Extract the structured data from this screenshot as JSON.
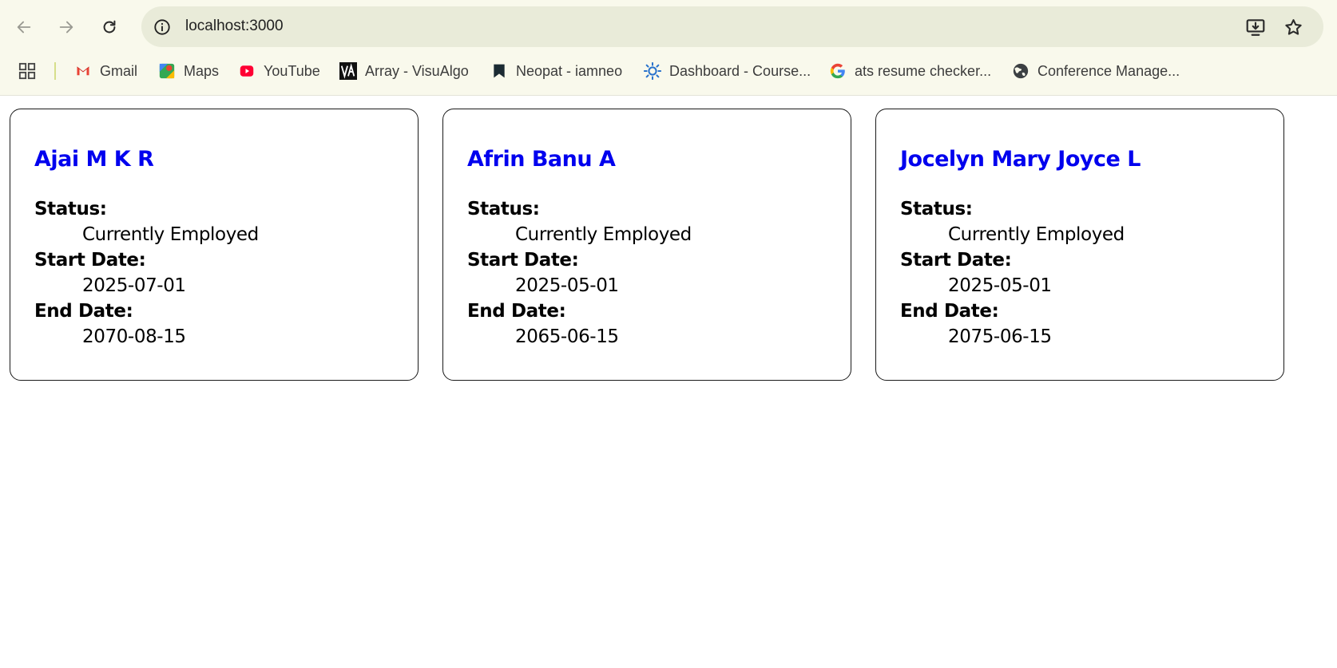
{
  "browser": {
    "url": "localhost:3000",
    "bookmarks": [
      {
        "label": "Gmail",
        "icon": "gmail-icon"
      },
      {
        "label": "Maps",
        "icon": "maps-icon"
      },
      {
        "label": "YouTube",
        "icon": "youtube-icon"
      },
      {
        "label": "Array - VisuAlgo",
        "icon": "visualgo-icon"
      },
      {
        "label": "Neopat - iamneo",
        "icon": "neopat-icon"
      },
      {
        "label": "Dashboard - Course...",
        "icon": "coursera-icon"
      },
      {
        "label": "ats resume checker...",
        "icon": "google-icon"
      },
      {
        "label": "Conference Manage...",
        "icon": "globe-icon"
      }
    ]
  },
  "employees": [
    {
      "name": "Ajai M K R",
      "status_label": "Status:",
      "status": "Currently Employed",
      "start_label": "Start Date:",
      "start_date": "2025-07-01",
      "end_label": "End Date:",
      "end_date": "2070-08-15"
    },
    {
      "name": "Afrin Banu A",
      "status_label": "Status:",
      "status": "Currently Employed",
      "start_label": "Start Date:",
      "start_date": "2025-05-01",
      "end_label": "End Date:",
      "end_date": "2065-06-15"
    },
    {
      "name": "Jocelyn Mary Joyce L",
      "status_label": "Status:",
      "status": "Currently Employed",
      "start_label": "Start Date:",
      "start_date": "2025-05-01",
      "end_label": "End Date:",
      "end_date": "2075-06-15"
    }
  ],
  "colors": {
    "name_link": "#0000ee",
    "chrome_bg": "#f9f9ec",
    "omnibox_bg": "#e9ebd9"
  }
}
